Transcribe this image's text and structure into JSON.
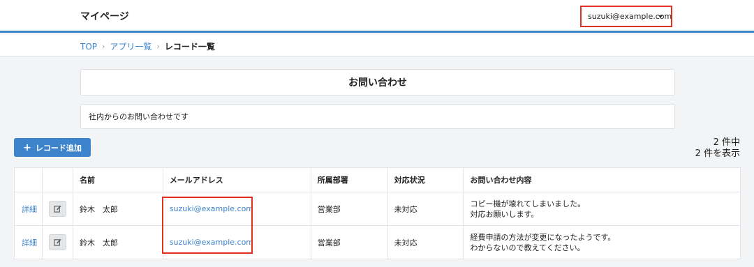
{
  "header": {
    "app_title": "マイページ",
    "user_email": "suzuki@example.com"
  },
  "breadcrumb": {
    "items": [
      "TOP",
      "アプリ一覧"
    ],
    "current": "レコード一覧",
    "separator": "›"
  },
  "app": {
    "title": "お問い合わせ",
    "description": "社内からのお問い合わせです"
  },
  "toolbar": {
    "add_label": "レコード追加"
  },
  "count": {
    "line1": "2 件中",
    "line2": "2 件を表示"
  },
  "table": {
    "columns": [
      "",
      "",
      "名前",
      "メールアドレス",
      "所属部署",
      "対応状況",
      "お問い合わせ内容"
    ],
    "detail_label": "詳細",
    "rows": [
      {
        "name": "鈴木　太郎",
        "email": "suzuki@example.com",
        "dept": "営業部",
        "status": "未対応",
        "content": [
          "コピー機が壊れてしまいました。",
          "対応お願いします。"
        ]
      },
      {
        "name": "鈴木　太郎",
        "email": "suzuki@example.com",
        "dept": "営業部",
        "status": "未対応",
        "content": [
          "経費申請の方法が変更になったようです。",
          "わからないので教えてください。"
        ]
      }
    ]
  },
  "colors": {
    "accent": "#3d84cc",
    "highlight": "#e0301e"
  },
  "icons": {
    "edit": "edit-icon",
    "add": "plus-icon",
    "dropdown": "caret-down-icon"
  }
}
